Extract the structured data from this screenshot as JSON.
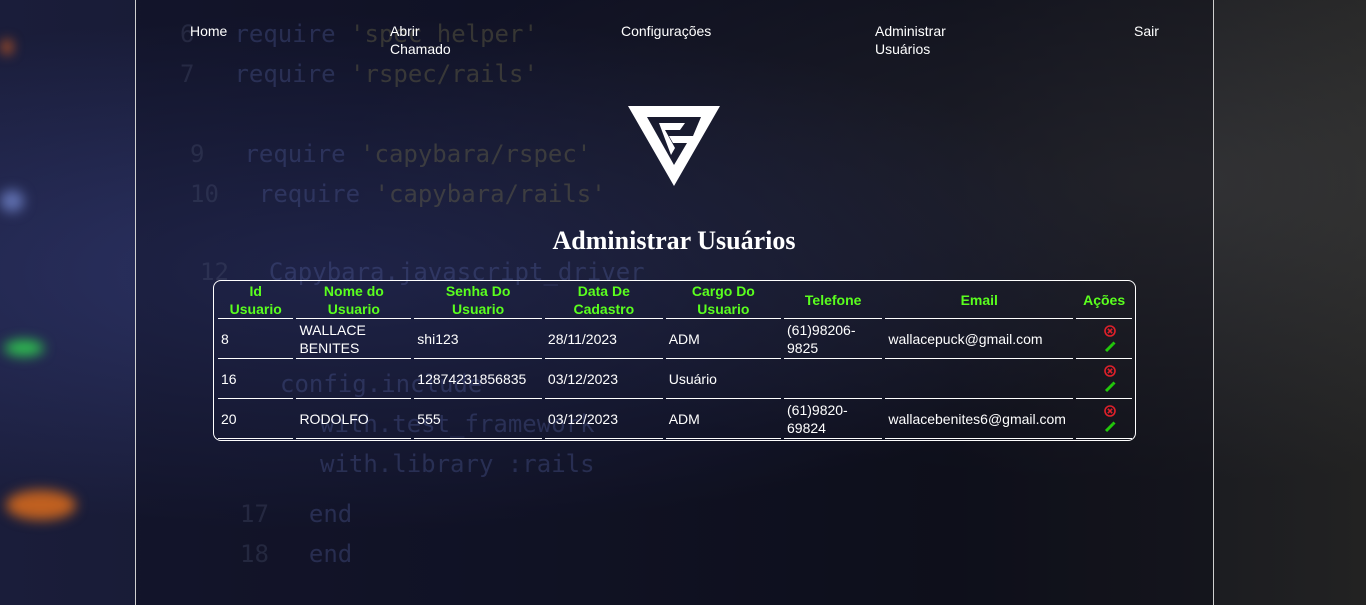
{
  "nav": {
    "home": "Home",
    "abrir_chamado_1": "Abrir",
    "abrir_chamado_2": "Chamado",
    "configuracoes": "Configurações",
    "administrar_1": "Administrar",
    "administrar_2": "Usuários",
    "sair": "Sair"
  },
  "page": {
    "title": "Administrar Usuários"
  },
  "table": {
    "headers": {
      "id_1": "Id",
      "id_2": "Usuario",
      "nome_1": "Nome do",
      "nome_2": "Usuario",
      "senha_1": "Senha Do",
      "senha_2": "Usuario",
      "data_1": "Data De",
      "data_2": "Cadastro",
      "cargo_1": "Cargo Do",
      "cargo_2": "Usuario",
      "telefone": "Telefone",
      "email": "Email",
      "acoes": "Ações"
    },
    "rows": [
      {
        "id": "8",
        "nome_1": "WALLACE",
        "nome_2": "BENITES",
        "senha": "shi123",
        "data": "28/11/2023",
        "cargo": "ADM",
        "tel_1": "(61)98206-",
        "tel_2": "9825",
        "email": "wallacepuck@gmail.com"
      },
      {
        "id": "16",
        "nome_1": "",
        "nome_2": "",
        "senha": "12874231856835",
        "data": "03/12/2023",
        "cargo": "Usuário",
        "tel_1": "",
        "tel_2": "",
        "email": ""
      },
      {
        "id": "20",
        "nome_1": "RODOLFO",
        "nome_2": "",
        "senha": "555",
        "data": "03/12/2023",
        "cargo": "ADM",
        "tel_1": "(61)9820-",
        "tel_2": "69824",
        "email": "wallacebenites6@gmail.com"
      }
    ]
  },
  "colors": {
    "header_text": "#5aff1e",
    "delete_icon": "#e0202a",
    "edit_icon": "#22c80a",
    "panel_border": "#cfcfcf"
  },
  "icons": {
    "delete": "circle-x-icon",
    "edit": "pencil-icon"
  }
}
